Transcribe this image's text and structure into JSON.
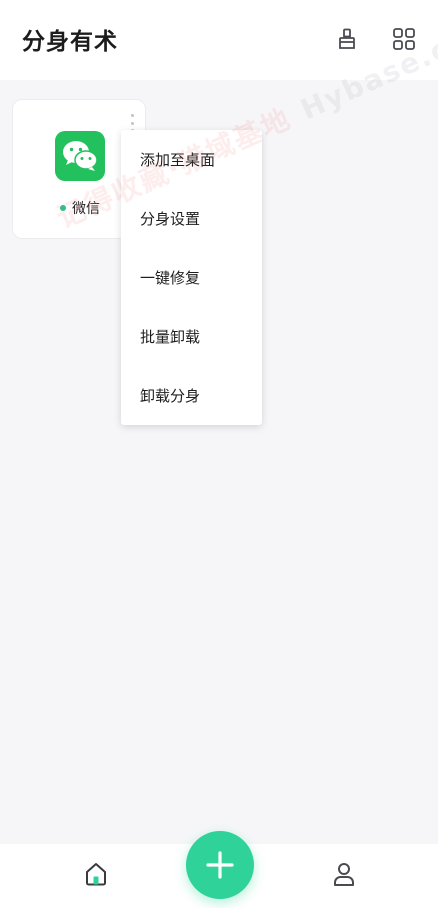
{
  "header": {
    "title": "分身有术",
    "actions": [
      {
        "icon": "brush-icon"
      },
      {
        "icon": "grid-icon"
      }
    ]
  },
  "apps": [
    {
      "name": "微信",
      "icon": "wechat-icon",
      "status_color": "#29c28b",
      "icon_color": "#22c15e"
    }
  ],
  "context_menu": {
    "items": [
      {
        "label": "添加至桌面"
      },
      {
        "label": "分身设置"
      },
      {
        "label": "一键修复"
      },
      {
        "label": "批量卸载"
      },
      {
        "label": "卸载分身"
      }
    ]
  },
  "watermark": {
    "text_cn": "记得收藏·猎域基地",
    "text_en": "Hybase.com"
  },
  "tabbar": {
    "home_icon": "home-icon",
    "add_icon": "plus-icon",
    "profile_icon": "user-icon",
    "accent": "#2fd39a"
  }
}
